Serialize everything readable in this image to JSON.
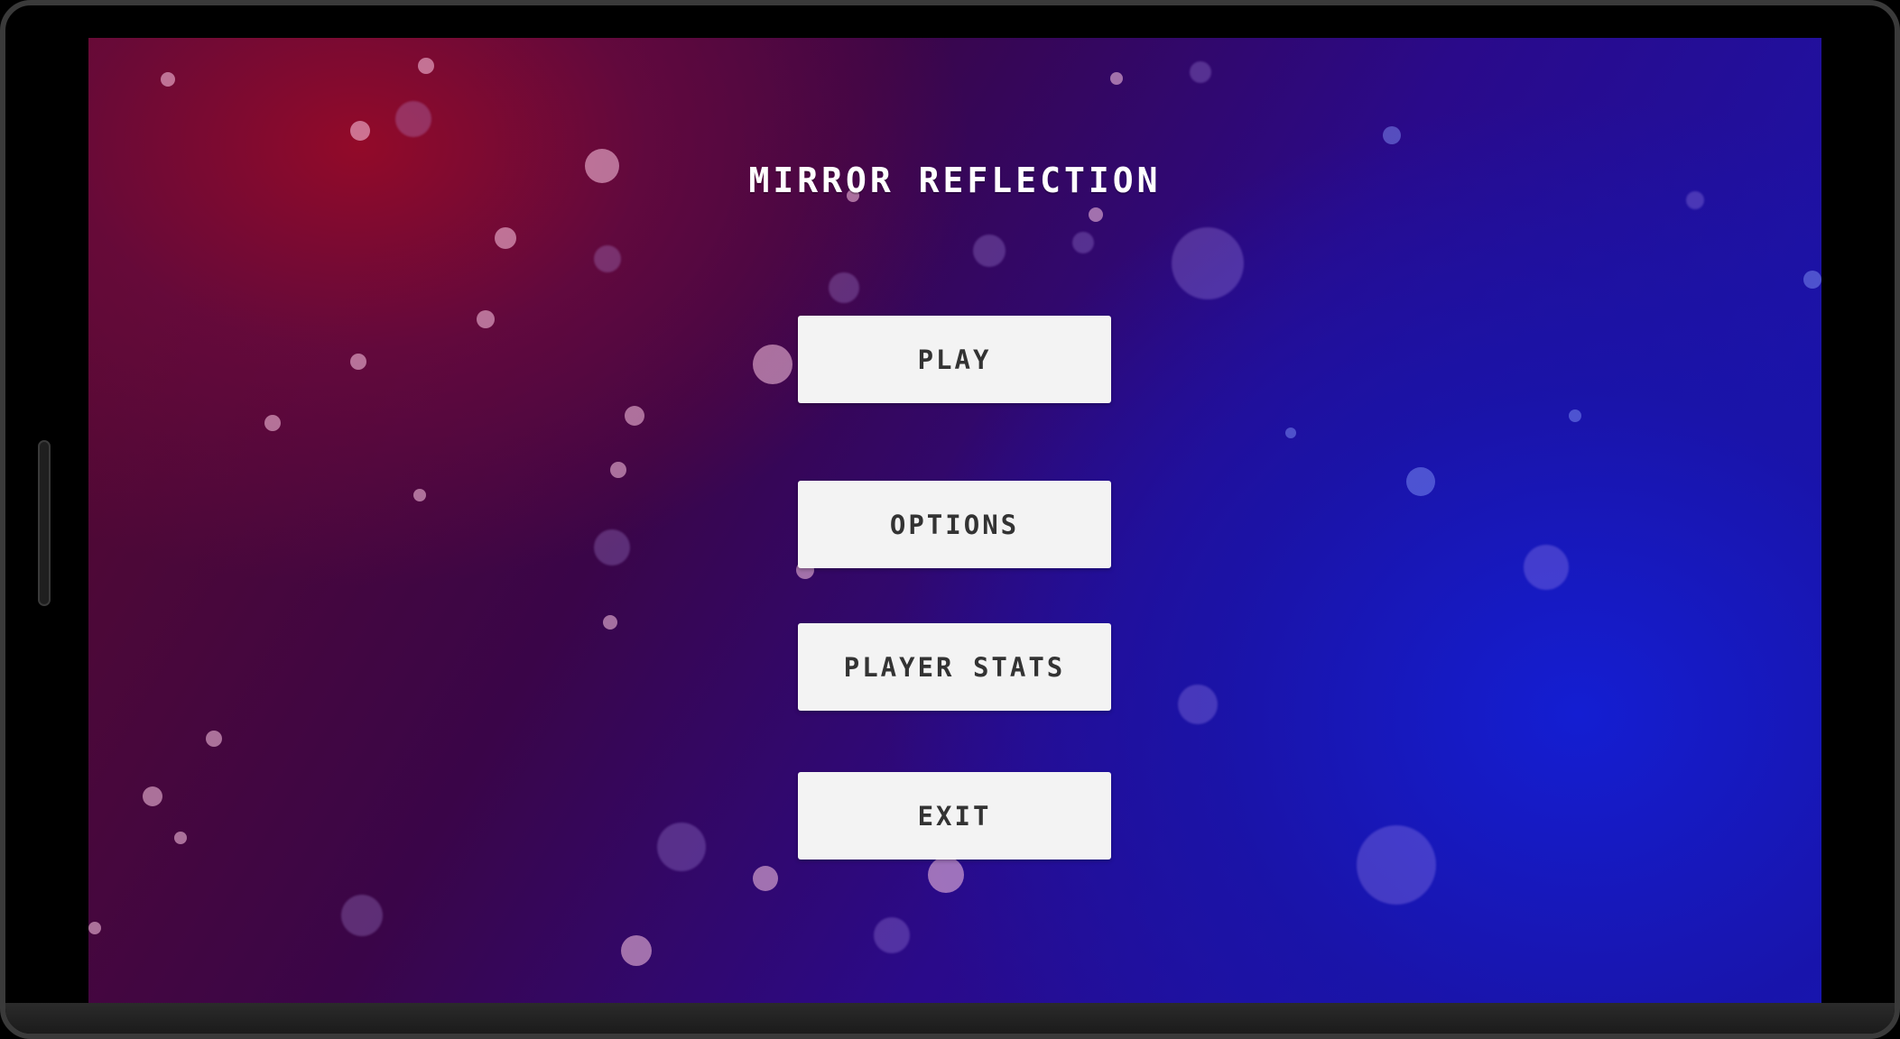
{
  "game": {
    "title": "MIRROR REFLECTION"
  },
  "menu": {
    "play_label": "PLAY",
    "options_label": "OPTIONS",
    "player_stats_label": "PLAYER STATS",
    "exit_label": "EXIT"
  },
  "theme": {
    "background_left": "#8a0a2a",
    "background_right": "#1418b8",
    "button_bg": "#f3f3f3",
    "button_text": "#333333",
    "title_text": "#ffffff"
  }
}
